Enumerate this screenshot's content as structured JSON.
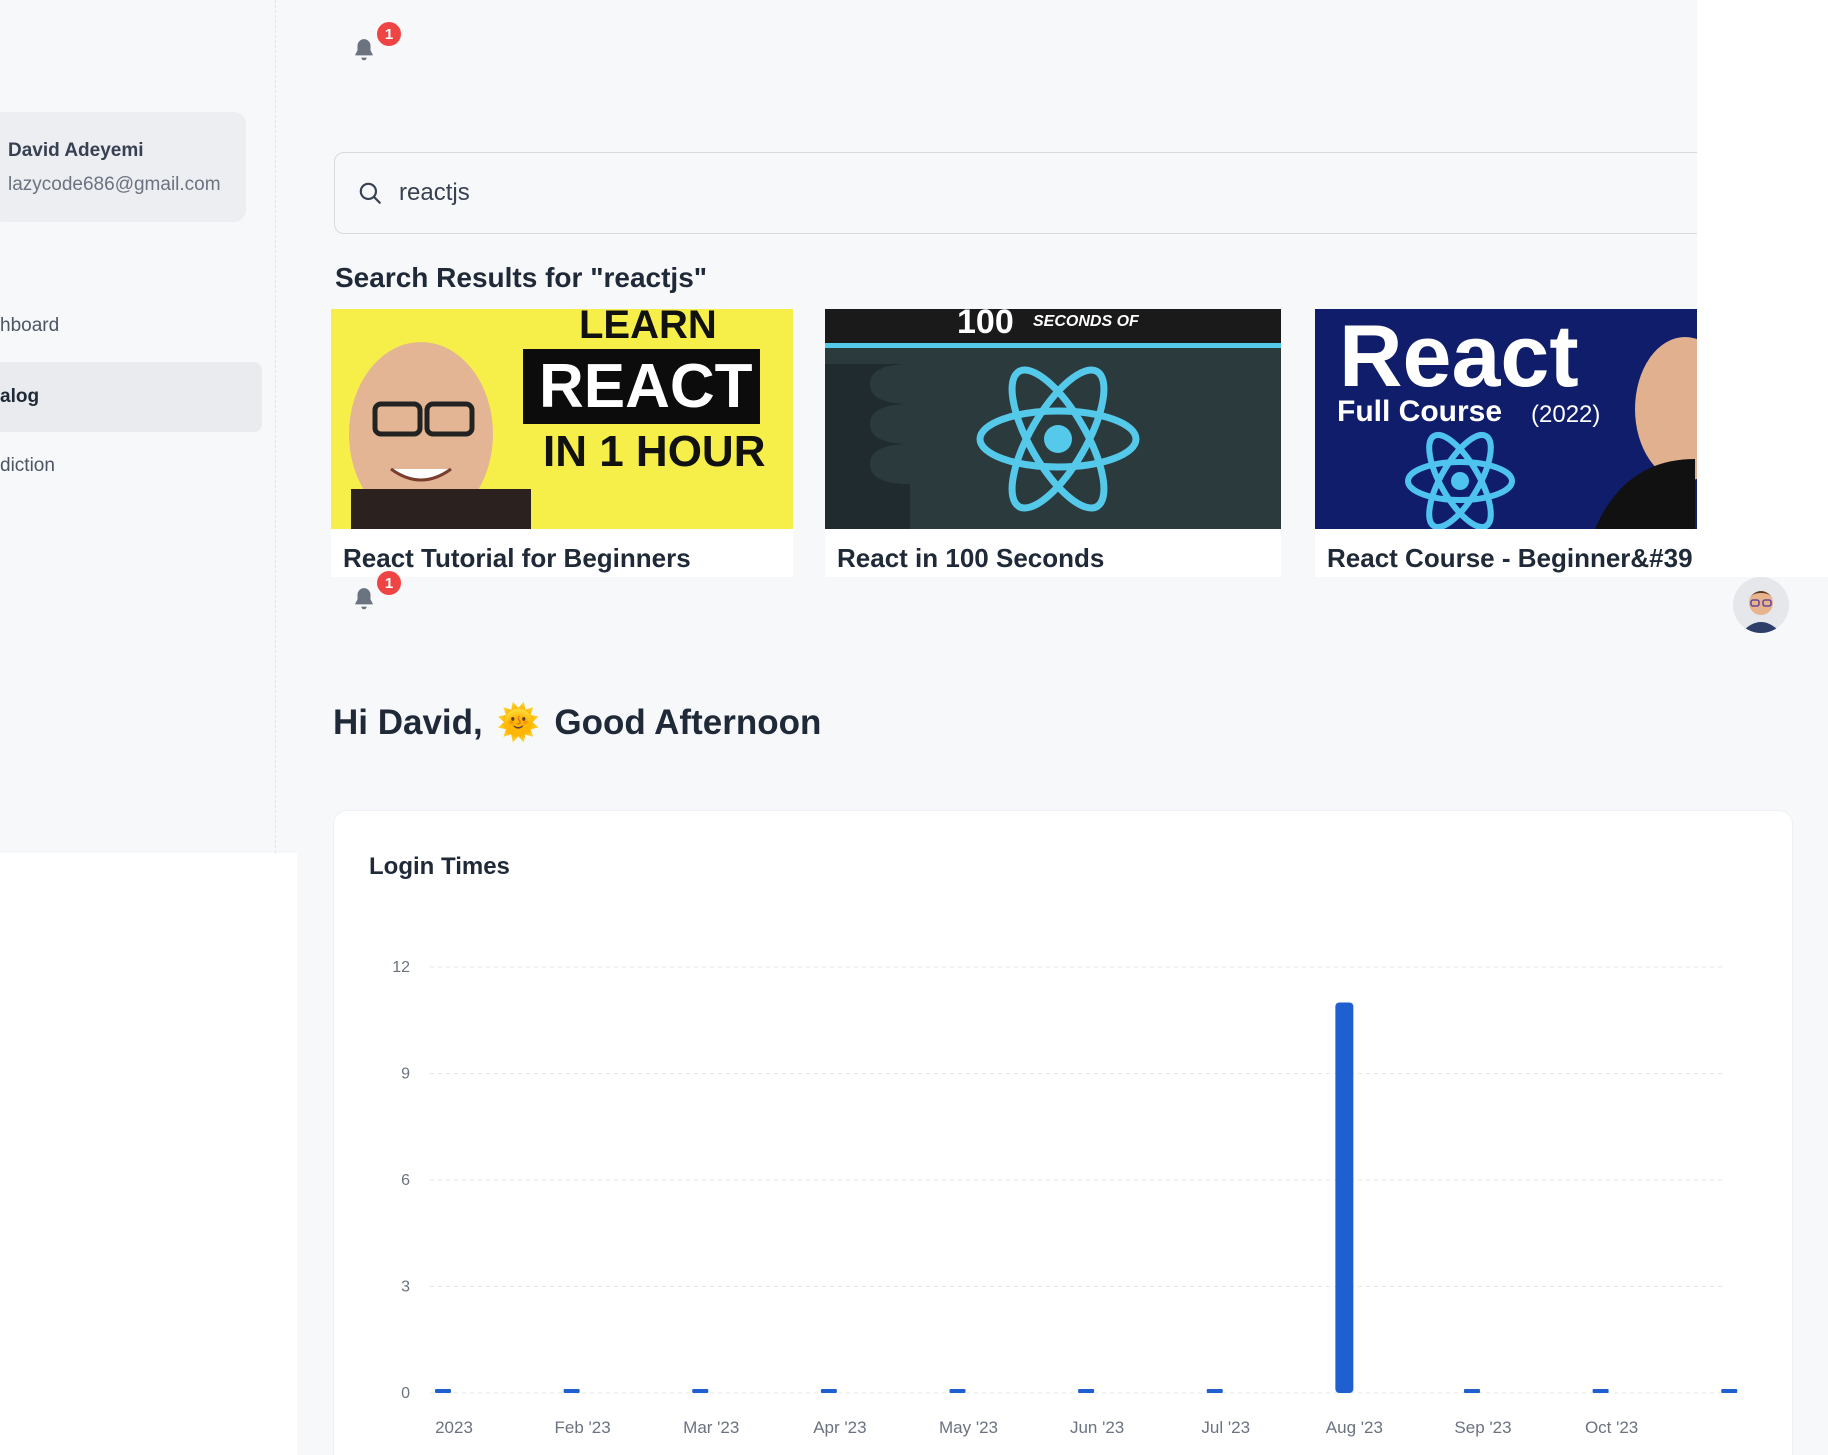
{
  "sidebar": {
    "user": {
      "name": "David Adeyemi",
      "email": "lazycode686@gmail.com"
    },
    "items": [
      {
        "label": "hboard"
      },
      {
        "label": "alog"
      },
      {
        "label": "diction"
      }
    ]
  },
  "notifications": {
    "count": "1"
  },
  "search": {
    "value": "reactjs",
    "placeholder": "Search",
    "results_title": "Search Results for \"reactjs\""
  },
  "videos": [
    {
      "title": "React Tutorial for Beginners",
      "thumb_text": [
        "LEARN",
        "REACT",
        "IN 1 HOUR"
      ]
    },
    {
      "title": "React in 100 Seconds",
      "thumb_text": [
        "100",
        "SECONDS OF"
      ]
    },
    {
      "title": "React Course - Beginner&#39",
      "thumb_text": [
        "React",
        "Full Course",
        "(2022)"
      ]
    }
  ],
  "greeting": {
    "hi": "Hi David,",
    "emoji": "🌞",
    "salutation": "Good Afternoon"
  },
  "chart_data": {
    "type": "bar",
    "title": "Login Times",
    "categories": [
      "2023",
      "Feb '23",
      "Mar '23",
      "Apr '23",
      "May '23",
      "Jun '23",
      "Jul '23",
      "Aug '23",
      "Sep '23",
      "Oct '23",
      ""
    ],
    "values": [
      0,
      0,
      0,
      0,
      0,
      0,
      0,
      11,
      0,
      0,
      0
    ],
    "yticks": [
      "0",
      "3",
      "6",
      "9",
      "12"
    ],
    "ylim": [
      0,
      12
    ],
    "grid": true,
    "color": "#1f5fd0"
  },
  "colors": {
    "accent": "#1f5fd0",
    "badge": "#ef4444",
    "background": "#f7f8fa"
  }
}
